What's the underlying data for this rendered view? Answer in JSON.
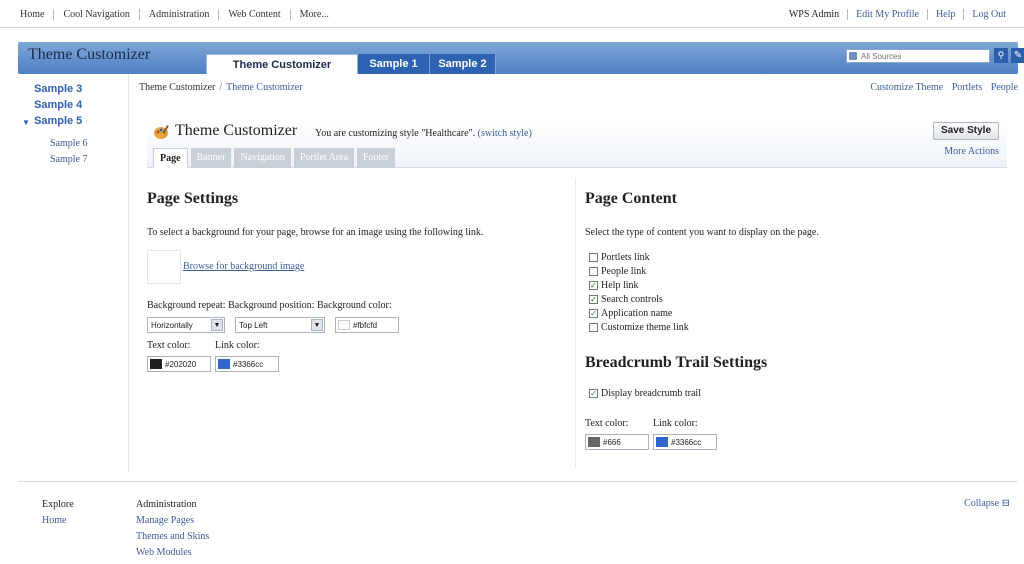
{
  "topnav": {
    "items": [
      "Home",
      "Cool Navigation",
      "Administration",
      "Web Content",
      "More..."
    ]
  },
  "toplinks": {
    "user": "WPS Admin",
    "items": [
      "Edit My Profile",
      "Help",
      "Log Out"
    ]
  },
  "banner": {
    "title": "Theme Customizer",
    "tabs": [
      "Theme Customizer",
      "Sample 1",
      "Sample 2"
    ],
    "search_placeholder": "All Sources"
  },
  "sidebar": {
    "items": [
      "Sample 3",
      "Sample 4",
      "Sample 5"
    ],
    "subitems": [
      "Sample 6",
      "Sample 7"
    ]
  },
  "breadcrumb": {
    "root": "Theme Customizer",
    "separator": "/",
    "current": "Theme Customizer"
  },
  "page_actions": [
    "Customize Theme",
    "Portlets",
    "People"
  ],
  "customizer": {
    "title": "Theme Customizer",
    "description": "You are customizing style \"Healthcare\".",
    "switch_link": "(switch style)",
    "save_label": "Save Style",
    "more_actions": "More Actions",
    "tabs": [
      "Page",
      "Banner",
      "Navigation",
      "Portlet Area",
      "Footer"
    ]
  },
  "page_settings": {
    "heading": "Page Settings",
    "instruction": "To select a background for your page, browse for an image using the following link.",
    "browse_link": "Browse for background image",
    "bg_labels": "Background repeat: Background position: Background color:",
    "repeat_value": "Horizontally",
    "position_value": "Top Left",
    "bg_color": "#fbfcfd",
    "text_color_label": "Text color:",
    "link_color_label": "Link color:",
    "text_color": "#202020",
    "link_color": "#3366cc"
  },
  "page_content": {
    "heading": "Page Content",
    "instruction": "Select the type of content you want to display on the page.",
    "options": [
      {
        "label": "Portlets link",
        "checked": false
      },
      {
        "label": "People link",
        "checked": false
      },
      {
        "label": "Help link",
        "checked": true
      },
      {
        "label": "Search controls",
        "checked": true
      },
      {
        "label": "Application name",
        "checked": true
      },
      {
        "label": "Customize theme link",
        "checked": false
      }
    ]
  },
  "breadcrumb_settings": {
    "heading": "Breadcrumb Trail Settings",
    "display_label": "Display breadcrumb trail",
    "text_color_label": "Text color:",
    "link_color_label": "Link color:",
    "text_color": "#666",
    "link_color": "#3366cc"
  },
  "footer": {
    "explore_heading": "Explore",
    "explore_links": [
      "Home"
    ],
    "admin_heading": "Administration",
    "admin_links": [
      "Manage Pages",
      "Themes and Skins",
      "Web Modules"
    ],
    "collapse_label": "Collapse"
  },
  "colors": {
    "banner_blue": "#4d7fc4",
    "tab_blue": "#2e63b3",
    "link_blue": "#3a5d9c",
    "text_swatch": "#202020",
    "link_swatch": "#3366cc",
    "crumb_text_swatch": "#666666"
  }
}
